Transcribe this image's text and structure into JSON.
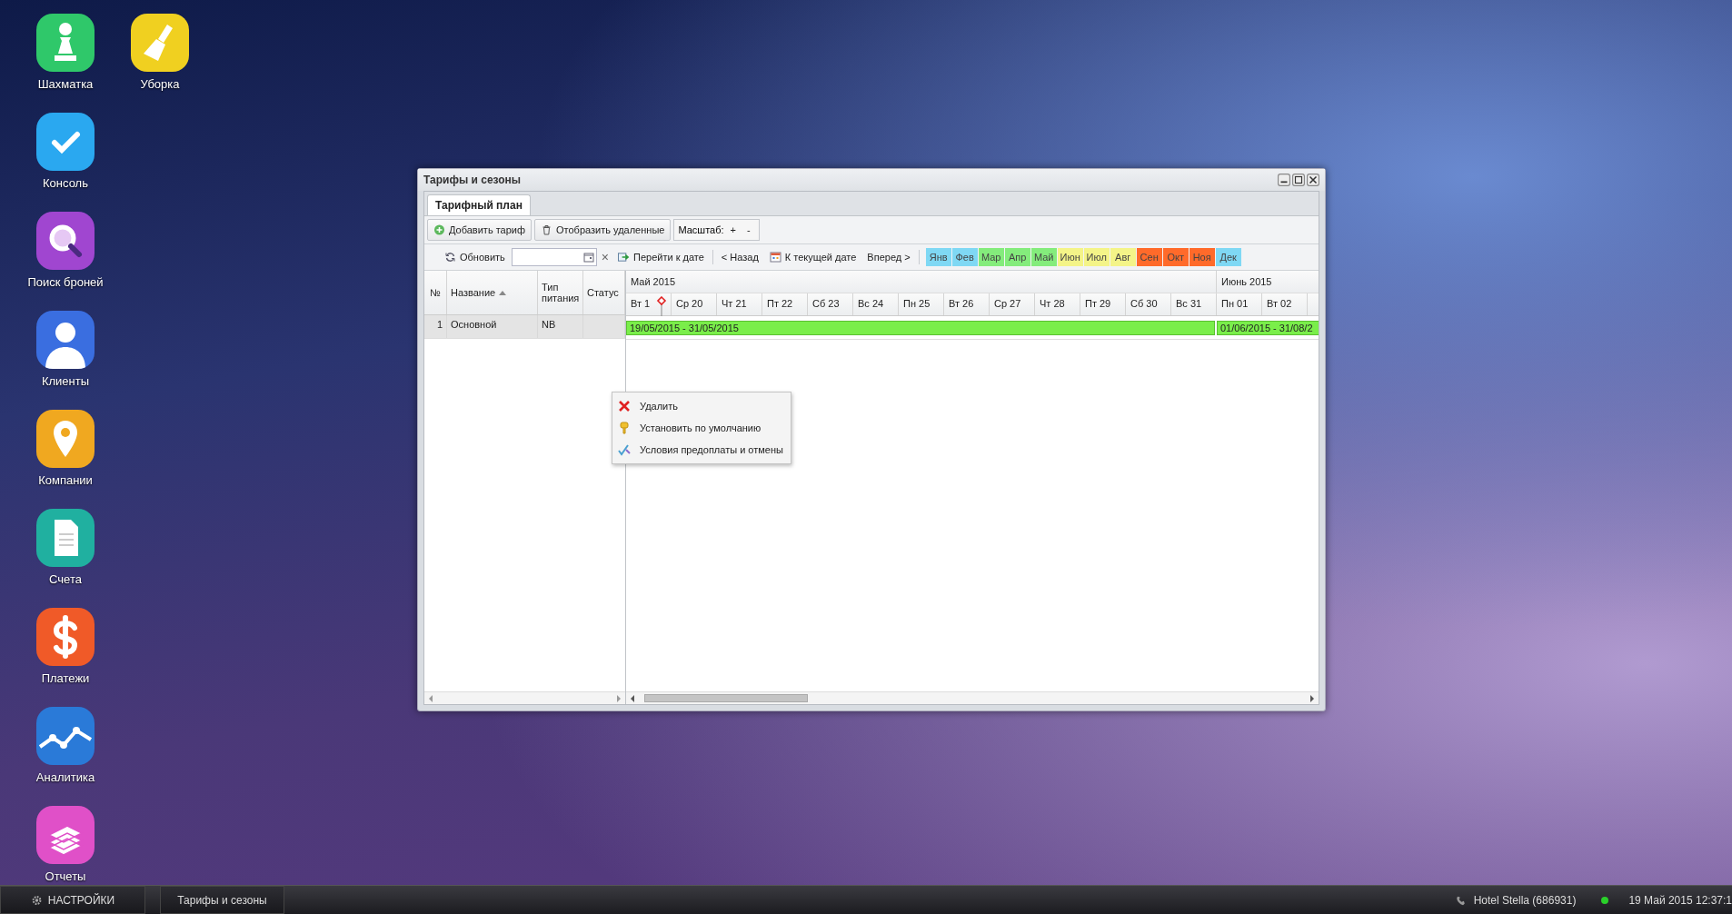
{
  "desktop_icons": [
    {
      "label": "Шахматка",
      "kind": "pawn",
      "color": "#2fc86a"
    },
    {
      "label": "Консоль",
      "kind": "check",
      "color": "#2aa8f0"
    },
    {
      "label": "Поиск броней",
      "kind": "search",
      "color": "#a046d0"
    },
    {
      "label": "Клиенты",
      "kind": "person",
      "color": "#3a6ee0"
    },
    {
      "label": "Компании",
      "kind": "pin",
      "color": "#f0a820"
    },
    {
      "label": "Счета",
      "kind": "document",
      "color": "#20b0a0"
    },
    {
      "label": "Платежи",
      "kind": "dollar",
      "color": "#f05a28"
    },
    {
      "label": "Аналитика",
      "kind": "chart",
      "color": "#2a7ad8"
    },
    {
      "label": "Отчеты",
      "kind": "books",
      "color": "#e050c8"
    },
    {
      "label": "Уборка",
      "kind": "broom",
      "color": "#f0d020"
    }
  ],
  "window": {
    "title": "Тарифы и сезоны",
    "tabs": [
      {
        "label": "Тарифный план",
        "selected": true
      }
    ],
    "toolbar": {
      "add": "Добавить тариф",
      "show_deleted": "Отобразить удаленные",
      "scale_label": "Масштаб:",
      "zoom_in": "+",
      "zoom_out": "-"
    },
    "nav": {
      "refresh": "Обновить",
      "clear": "×",
      "goto": "Перейти к дате",
      "back": "< Назад",
      "today": "К текущей дате",
      "forward": "Вперед >"
    },
    "months": [
      {
        "label": "Янв",
        "color": "#7fd8f4"
      },
      {
        "label": "Фев",
        "color": "#7fd8f4"
      },
      {
        "label": "Мар",
        "color": "#84ec7c"
      },
      {
        "label": "Апр",
        "color": "#84ec7c"
      },
      {
        "label": "Май",
        "color": "#84ec7c"
      },
      {
        "label": "Июн",
        "color": "#f4f488"
      },
      {
        "label": "Июл",
        "color": "#f4f488"
      },
      {
        "label": "Авг",
        "color": "#f4f488"
      },
      {
        "label": "Сен",
        "color": "#ff6a2a"
      },
      {
        "label": "Окт",
        "color": "#ff6a2a"
      },
      {
        "label": "Ноя",
        "color": "#ff6a2a"
      },
      {
        "label": "Дек",
        "color": "#7fd8f4"
      }
    ],
    "grid": {
      "columns": [
        "№",
        "Название",
        "Тип питания",
        "Статус"
      ],
      "month_headers": [
        "Май 2015",
        "Июнь 2015"
      ],
      "days": [
        "Вт 1",
        "Ср 20",
        "Чт 21",
        "Пт 22",
        "Сб 23",
        "Вс 24",
        "Пн 25",
        "Вт 26",
        "Ср 27",
        "Чт 28",
        "Пт 29",
        "Сб 30",
        "Вс 31",
        "Пн 01",
        "Вт 02"
      ],
      "rows": [
        {
          "number": "1",
          "name": "Основной",
          "meal": "NB",
          "selected": true,
          "periods": [
            "19/05/2015 - 31/05/2015",
            "01/06/2015 - 31/08/2"
          ]
        }
      ]
    },
    "context_menu": [
      {
        "label": "Удалить",
        "kind": "delete"
      },
      {
        "label": "Установить по умолчанию",
        "kind": "key"
      },
      {
        "label": "Условия предоплаты и отмены",
        "kind": "conditions"
      }
    ]
  },
  "taskbar": {
    "settings": "НАСТРОЙКИ",
    "tasks": [
      {
        "label": "Тарифы и сезоны",
        "selected": false
      }
    ],
    "hotel": "Hotel Stella (686931)",
    "online": true,
    "clock": "19 Май 2015 12:37:1"
  }
}
